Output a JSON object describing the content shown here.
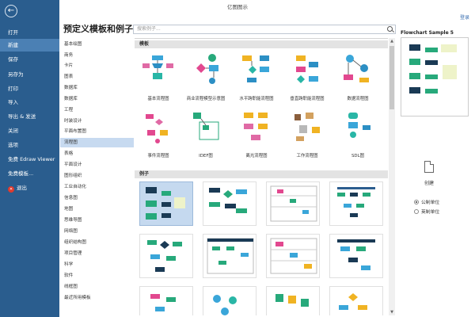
{
  "window": {
    "title": "亿图图示",
    "login": "登录"
  },
  "sidebar": {
    "items": [
      {
        "label": "打开",
        "name": "sidebar-item-open"
      },
      {
        "label": "新建",
        "name": "sidebar-item-new",
        "active": true
      },
      {
        "label": "保存",
        "name": "sidebar-item-save"
      },
      {
        "label": "另存为",
        "name": "sidebar-item-save-as"
      },
      {
        "label": "打印",
        "name": "sidebar-item-print"
      },
      {
        "label": "导入",
        "name": "sidebar-item-import"
      },
      {
        "label": "导出 & 发送",
        "name": "sidebar-item-export-send"
      },
      {
        "label": "关闭",
        "name": "sidebar-item-close"
      },
      {
        "label": "选项",
        "name": "sidebar-item-options"
      },
      {
        "label": "免费 Edraw Viewer",
        "name": "sidebar-item-edraw-viewer"
      },
      {
        "label": "免费模板...",
        "name": "sidebar-item-free-templates"
      },
      {
        "label": "退出",
        "name": "sidebar-item-exit",
        "icon": "exit-icon"
      }
    ]
  },
  "main": {
    "title": "预定义模板和例子",
    "search_placeholder": "搜索例子..."
  },
  "categories": [
    "基本绘图",
    "商务",
    "卡片",
    "图表",
    "数据库",
    "数据库",
    "工程",
    "时装设计",
    "平面布置图",
    "流程图",
    "表格",
    "平面设计",
    "图形组织",
    "工业自动化",
    "信息图",
    "地图",
    "思维导图",
    "网络图",
    "组织结构图",
    "项目管理",
    "科学",
    "软件",
    "线框图",
    "最近所用模板"
  ],
  "active_category": "流程图",
  "sections": {
    "templates": "模板",
    "examples": "例子"
  },
  "templates": [
    {
      "label": "基本流程图",
      "icon": "basic-flowchart-icon"
    },
    {
      "label": "商业流程模型示意图",
      "icon": "business-process-icon"
    },
    {
      "label": "水平跨职能流程图",
      "icon": "horizontal-crossfunc-icon"
    },
    {
      "label": "垂直跨职能流程图",
      "icon": "vertical-crossfunc-icon"
    },
    {
      "label": "数据流程图",
      "icon": "data-flow-icon"
    },
    {
      "label": "事件流程图",
      "icon": "event-flow-icon"
    },
    {
      "label": "IDEF图",
      "icon": "idef-icon"
    },
    {
      "label": "离光流程图",
      "icon": "light-flow-icon"
    },
    {
      "label": "工作流程图",
      "icon": "workflow-icon"
    },
    {
      "label": "SDL图",
      "icon": "sdl-icon"
    }
  ],
  "preview": {
    "title": "Flowchart Sample 5"
  },
  "create": {
    "label": "创建"
  },
  "units": {
    "metric": "公制单位",
    "imperial": "英制单位"
  }
}
